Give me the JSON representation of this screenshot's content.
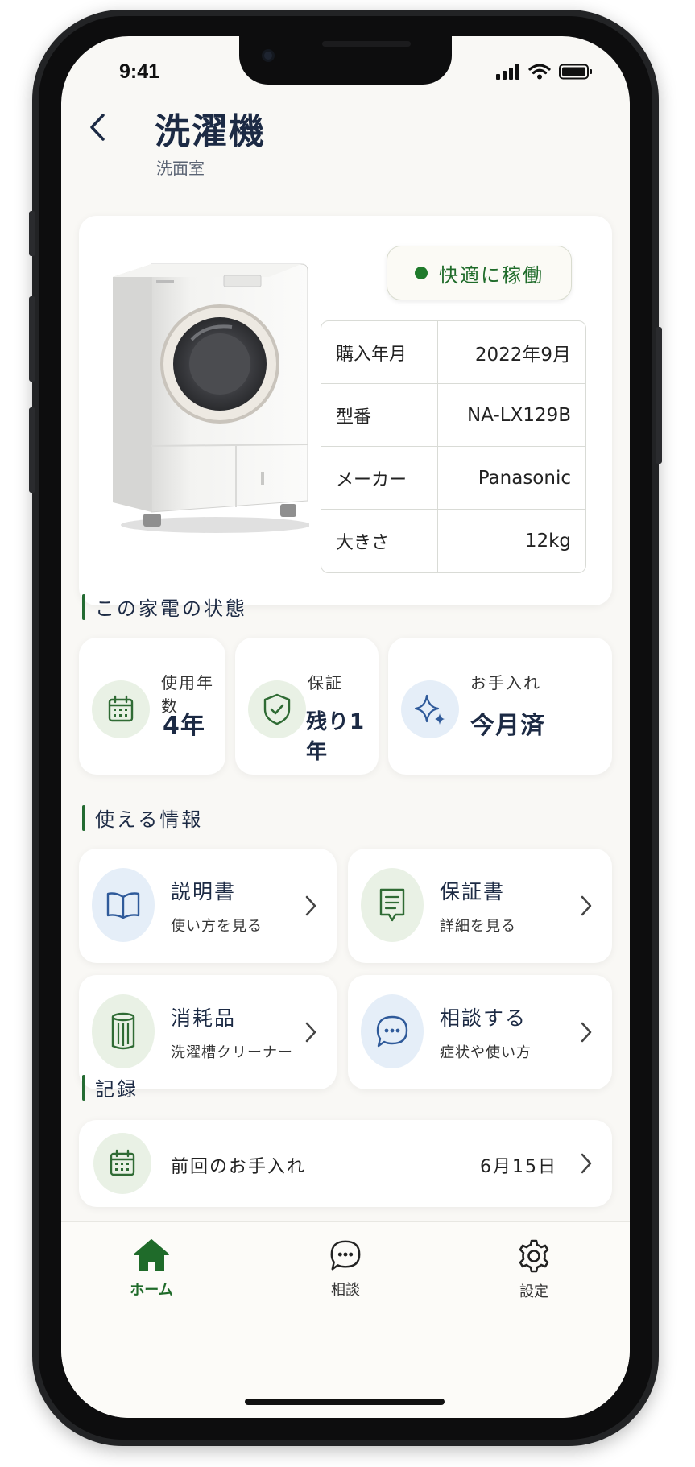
{
  "status_bar": {
    "time": "9:41"
  },
  "header": {
    "title": "洗濯機",
    "subtitle": "洗面室"
  },
  "product": {
    "status": "快適に稼働",
    "specs": [
      {
        "label": "購入年月",
        "value": "2022年9月"
      },
      {
        "label": "型番",
        "value": "NA-LX129B"
      },
      {
        "label": "メーカー",
        "value": "Panasonic"
      },
      {
        "label": "大きさ",
        "value": "12kg"
      }
    ]
  },
  "condition": {
    "heading": "この家電の状態",
    "tiles": [
      {
        "label": "使用年数",
        "value": "4年",
        "icon": "calendar-icon"
      },
      {
        "label": "保証",
        "value": "残り1年",
        "icon": "shield-check-icon"
      },
      {
        "label": "お手入れ",
        "value": "今月済",
        "icon": "sparkle-icon"
      }
    ]
  },
  "info": {
    "heading": "使える情報",
    "cards": [
      {
        "title": "説明書",
        "sub": "使い方を見る",
        "icon": "book-icon"
      },
      {
        "title": "保証書",
        "sub": "詳細を見る",
        "icon": "document-icon"
      },
      {
        "title": "消耗品",
        "sub": "洗濯槽クリーナー",
        "icon": "cleaner-bottle-icon"
      },
      {
        "title": "相談する",
        "sub": "症状や使い方",
        "icon": "chat-icon"
      }
    ]
  },
  "records": {
    "heading": "記録",
    "items": [
      {
        "label": "前回のお手入れ",
        "date": "6月15日",
        "icon": "calendar-icon"
      }
    ]
  },
  "tabbar": {
    "tabs": [
      {
        "label": "ホーム",
        "icon": "home-icon",
        "active": true
      },
      {
        "label": "相談",
        "icon": "chat-icon",
        "active": false
      },
      {
        "label": "設定",
        "icon": "gear-icon",
        "active": false
      }
    ]
  },
  "colors": {
    "accent": "#1f6b2a",
    "background": "#f9f8f5",
    "navy": "#1c2a44"
  }
}
